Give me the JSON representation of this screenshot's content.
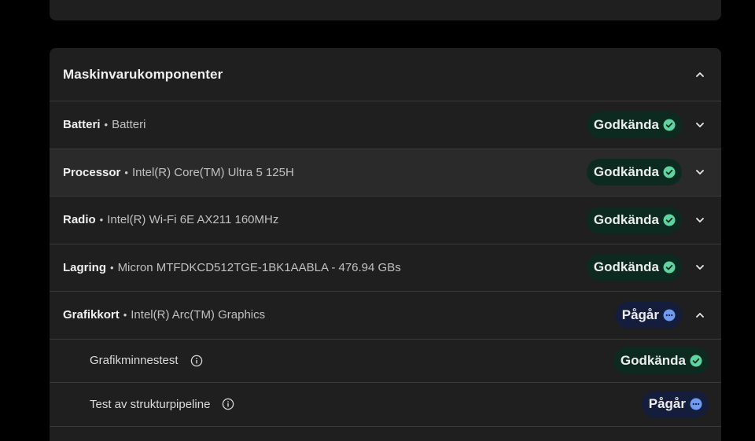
{
  "panel": {
    "title": "Maskinvarukomponenter",
    "rows": [
      {
        "name": "Batteri",
        "detail": "Batteri",
        "status": "Godkända"
      },
      {
        "name": "Processor",
        "detail": "Intel(R) Core(TM) Ultra 5 125H",
        "status": "Godkända"
      },
      {
        "name": "Radio",
        "detail": "Intel(R) Wi-Fi 6E AX211 160MHz",
        "status": "Godkända"
      },
      {
        "name": "Lagring",
        "detail": "Micron MTFDKCD512TGE-1BK1AABLA - 476.94 GBs",
        "status": "Godkända"
      },
      {
        "name": "Grafikkort",
        "detail": "Intel(R) Arc(TM) Graphics",
        "status": "Pågår"
      }
    ],
    "subtests": [
      {
        "name": "Grafikminnestest",
        "status": "Godkända"
      },
      {
        "name": "Test av strukturpipeline",
        "status": "Pågår"
      }
    ],
    "separator": "•"
  },
  "colors": {
    "pass_check": "#5fd4a0",
    "progress_dots": "#6f9bf0"
  },
  "icons": {
    "pass": "check-circle-icon",
    "progress": "more-circle-icon",
    "info": "info-icon",
    "expand": "chevron-down-icon",
    "collapse": "chevron-up-icon"
  }
}
